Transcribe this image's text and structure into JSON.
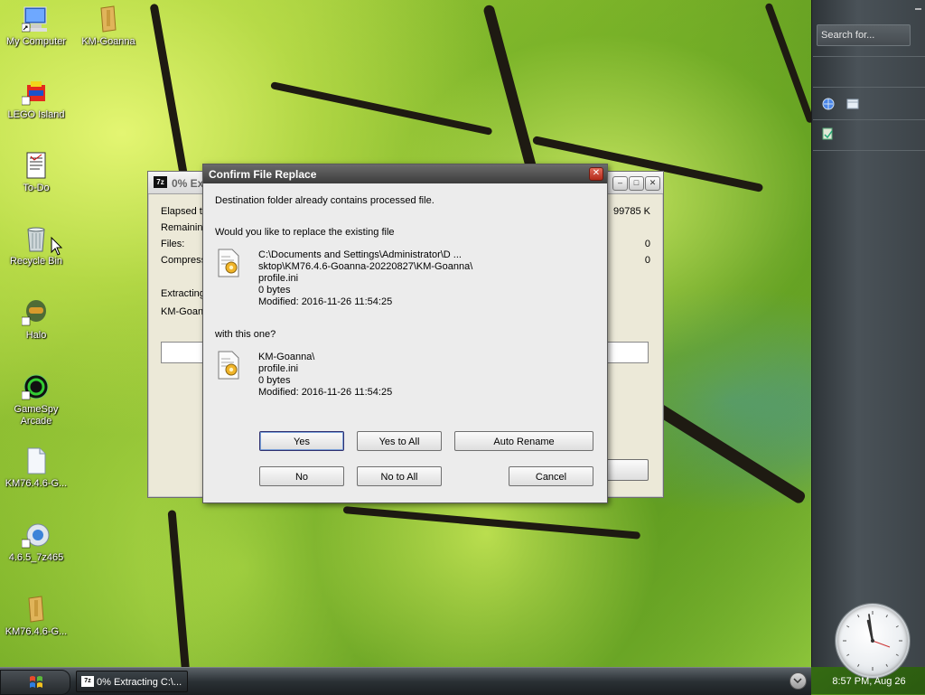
{
  "desktop": {
    "icons": [
      {
        "label": "My Computer"
      },
      {
        "label": "KM-Goanna"
      },
      {
        "label": "LEGO Island"
      },
      {
        "label": "To-Do"
      },
      {
        "label": "Recycle Bin"
      },
      {
        "label": "Halo"
      },
      {
        "label": "GameSpy\nArcade"
      },
      {
        "label": "KM76.4.6-G..."
      },
      {
        "label": "4.6.5_7z465"
      },
      {
        "label": "KM76.4.6-G..."
      }
    ]
  },
  "bg_window": {
    "title": "0% Ex",
    "app_icon": "7z",
    "rows": {
      "elapsed": "Elapsed ti",
      "remaining": "Remaining",
      "files": "Files:",
      "compress": "Compress",
      "extracting": "Extracting",
      "path": "KM-Goan"
    },
    "values": {
      "size": "99785 K",
      "files": "0",
      "compress": "0"
    }
  },
  "dialog": {
    "title": "Confirm File Replace",
    "message": "Destination folder already contains processed file.",
    "question": "Would you like to replace the existing file",
    "existing": {
      "line1": "C:\\Documents and Settings\\Administrator\\D ...",
      "line2": "sktop\\KM76.4.6-Goanna-20220827\\KM-Goanna\\",
      "line3": "profile.ini",
      "line4": "0 bytes",
      "line5": "Modified: 2016-11-26 11:54:25"
    },
    "with_this": "with this one?",
    "new": {
      "line1": "KM-Goanna\\",
      "line2": "profile.ini",
      "line3": "0 bytes",
      "line4": "Modified: 2016-11-26 11:54:25"
    },
    "buttons": {
      "yes": "Yes",
      "yes_all": "Yes to All",
      "auto_rename": "Auto Rename",
      "no": "No",
      "no_all": "No to All",
      "cancel": "Cancel"
    },
    "close_glyph": "✕"
  },
  "sidebar": {
    "search_placeholder": "Search for...",
    "clock_text": "8:57 PM, Aug 26"
  },
  "taskbar": {
    "item_label": "0% Extracting C:\\...",
    "item_icon": "7z"
  },
  "colors": {
    "dialog_title": "#4a4a4a",
    "close": "#c8402f"
  }
}
